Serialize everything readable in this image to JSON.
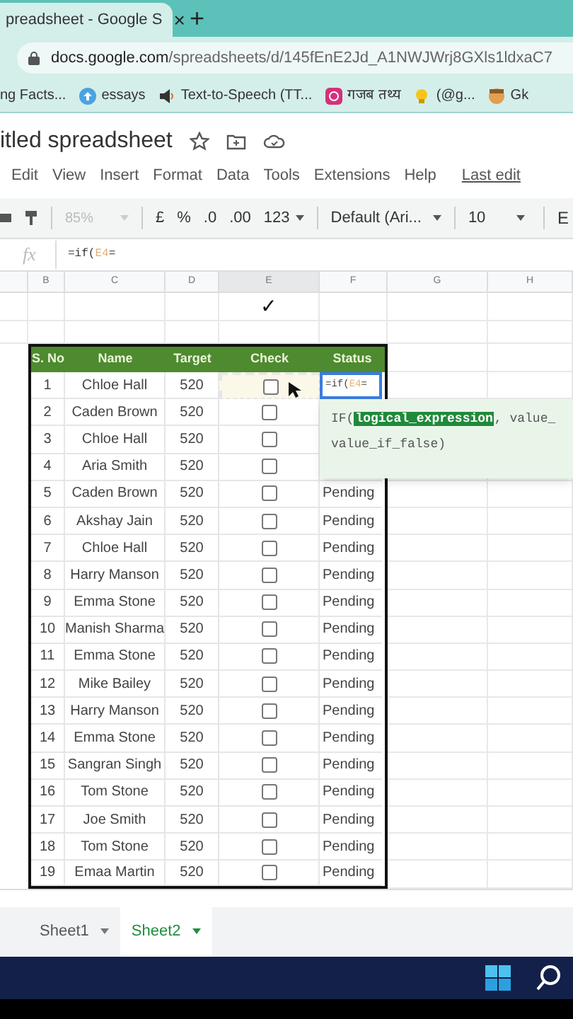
{
  "browser": {
    "tab": {
      "title": "preadsheet - Google S",
      "close": "×",
      "selected": true
    },
    "new_tab": "+",
    "url": {
      "host": "docs.google.com",
      "path": "/spreadsheets/d/145fEnE2Jd_A1NWJWrj8GXls1ldxaC7"
    },
    "bookmarks": [
      {
        "label": "ng Facts...",
        "kind": "none"
      },
      {
        "label": "essays",
        "kind": "upload"
      },
      {
        "label": "Text-to-Speech (TT...",
        "kind": "speaker"
      },
      {
        "label": "गजब तथ्य",
        "kind": "camera"
      },
      {
        "label": "(@g...",
        "kind": "bulb"
      },
      {
        "label": "Gk",
        "kind": "face"
      }
    ]
  },
  "doc": {
    "title": "itled spreadsheet",
    "menu": [
      "Edit",
      "View",
      "Insert",
      "Format",
      "Data",
      "Tools",
      "Extensions",
      "Help"
    ],
    "last_edit": "Last edit"
  },
  "toolbar": {
    "zoom": "85%",
    "currency": "£",
    "percent": "%",
    "decrease_decimals": ".0",
    "increase_decimals": ".00",
    "number_format": "123",
    "font": "Default (Ari...",
    "font_size": "10",
    "cut_item": "E"
  },
  "formula_bar": {
    "fx": "fx",
    "prefix": "=if(",
    "ref": "E4",
    "suffix": "="
  },
  "columns": [
    "B",
    "C",
    "D",
    "E",
    "F",
    "G",
    "H"
  ],
  "tick": "✓",
  "table": {
    "headers": [
      "S. No",
      "Name",
      "Target",
      "Check",
      "Status"
    ],
    "rows": [
      {
        "no": "1",
        "name": "Chloe Hall",
        "target": "520",
        "checked": false,
        "marked": true,
        "editing": {
          "prefix": "=if(",
          "ref": "E4",
          "suffix": "="
        }
      },
      {
        "no": "2",
        "name": "Caden Brown",
        "target": "520",
        "checked": false,
        "marked": false
      },
      {
        "no": "3",
        "name": "Chloe Hall",
        "target": "520",
        "checked": false,
        "marked": false
      },
      {
        "no": "4",
        "name": "Aria Smith",
        "target": "520",
        "checked": false,
        "marked": false
      },
      {
        "no": "5",
        "name": "Caden Brown",
        "target": "520",
        "checked": false,
        "marked": false,
        "status": "Pending"
      },
      {
        "no": "6",
        "name": "Akshay Jain",
        "target": "520",
        "checked": false,
        "marked": false,
        "status": "Pending"
      },
      {
        "no": "7",
        "name": "Chloe Hall",
        "target": "520",
        "checked": false,
        "marked": false,
        "status": "Pending"
      },
      {
        "no": "8",
        "name": "Harry Manson",
        "target": "520",
        "checked": false,
        "marked": false,
        "status": "Pending"
      },
      {
        "no": "9",
        "name": "Emma Stone",
        "target": "520",
        "checked": false,
        "marked": false,
        "status": "Pending"
      },
      {
        "no": "10",
        "name": "Manish Sharma",
        "target": "520",
        "checked": false,
        "marked": false,
        "status": "Pending"
      },
      {
        "no": "11",
        "name": "Emma Stone",
        "target": "520",
        "checked": false,
        "marked": false,
        "status": "Pending"
      },
      {
        "no": "12",
        "name": "Mike Bailey",
        "target": "520",
        "checked": false,
        "marked": false,
        "status": "Pending"
      },
      {
        "no": "13",
        "name": "Harry Manson",
        "target": "520",
        "checked": false,
        "marked": false,
        "status": "Pending"
      },
      {
        "no": "14",
        "name": "Emma Stone",
        "target": "520",
        "checked": false,
        "marked": false,
        "status": "Pending"
      },
      {
        "no": "15",
        "name": "Sangran Singh",
        "target": "520",
        "checked": false,
        "marked": false,
        "status": "Pending"
      },
      {
        "no": "16",
        "name": "Tom Stone",
        "target": "520",
        "checked": false,
        "marked": false,
        "status": "Pending"
      },
      {
        "no": "17",
        "name": "Joe Smith",
        "target": "520",
        "checked": false,
        "marked": false,
        "status": "Pending"
      },
      {
        "no": "18",
        "name": "Tom Stone",
        "target": "520",
        "checked": false,
        "marked": false,
        "status": "Pending"
      },
      {
        "no": "19",
        "name": "Emaa Martin",
        "target": "520",
        "checked": false,
        "marked": false,
        "status": "Pending"
      }
    ]
  },
  "tooltip": {
    "func": "IF(",
    "arg": "logical_expression",
    "rest": ", value_",
    "line2": "value_if_false)"
  },
  "sheets": [
    {
      "label": "Sheet1",
      "selected": false
    },
    {
      "label": "Sheet2",
      "selected": true
    }
  ]
}
